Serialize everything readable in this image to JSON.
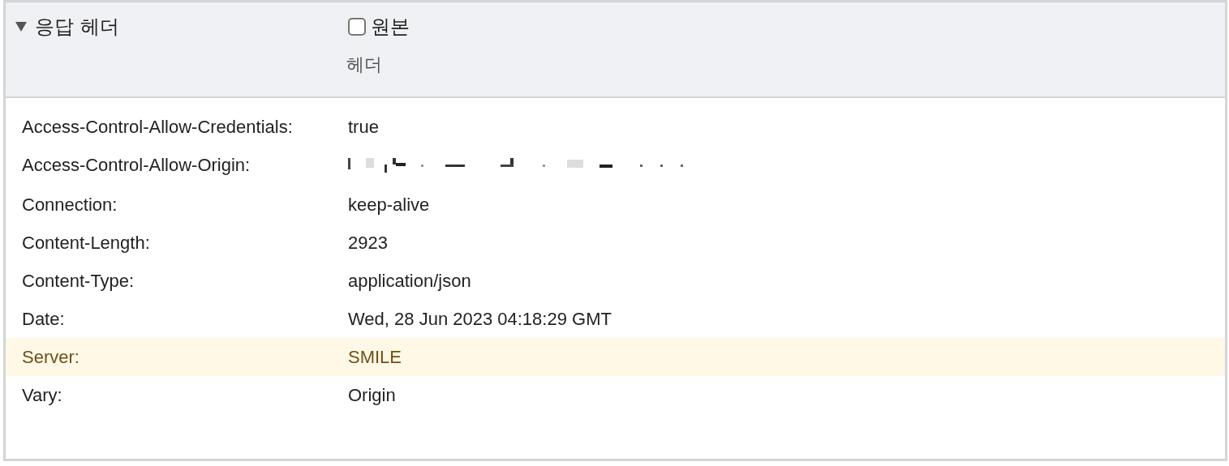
{
  "section": {
    "title": "응답 헤더",
    "expanded": true,
    "raw_toggle": {
      "label": "원본",
      "checked": false
    },
    "column_label": "헤더"
  },
  "headers": [
    {
      "name": "Access-Control-Allow-Credentials:",
      "value": "true",
      "kind": "text",
      "selected": false
    },
    {
      "name": "Access-Control-Allow-Origin:",
      "kind": "redacted",
      "selected": false
    },
    {
      "name": "Connection:",
      "value": "keep-alive",
      "kind": "text",
      "selected": false
    },
    {
      "name": "Content-Length:",
      "value": "2923",
      "kind": "text",
      "selected": false
    },
    {
      "name": "Content-Type:",
      "value": "application/json",
      "kind": "text",
      "selected": false
    },
    {
      "name": "Date:",
      "value": "Wed, 28 Jun 2023 04:18:29 GMT",
      "kind": "text",
      "selected": false
    },
    {
      "name": "Server:",
      "value": "SMILE",
      "kind": "text",
      "selected": true
    },
    {
      "name": "Vary:",
      "value": "Origin",
      "kind": "text",
      "selected": false
    }
  ]
}
